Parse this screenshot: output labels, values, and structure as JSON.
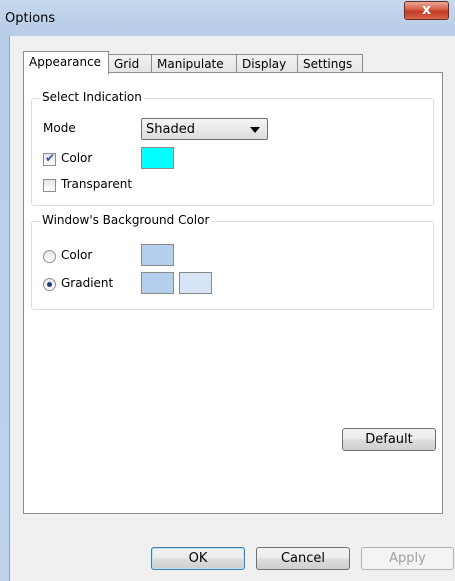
{
  "window": {
    "title": "Options",
    "close_glyph": "x"
  },
  "tabs": [
    {
      "label": "Appearance",
      "active": true
    },
    {
      "label": "Grid",
      "active": false
    },
    {
      "label": "Manipulate",
      "active": false
    },
    {
      "label": "Display",
      "active": false
    },
    {
      "label": "Settings",
      "active": false
    }
  ],
  "select_indication": {
    "legend": "Select Indication",
    "mode_label": "Mode",
    "mode_value": "Shaded",
    "color_label": "Color",
    "color_checked": true,
    "color_value": "#00ffff",
    "transparent_label": "Transparent",
    "transparent_checked": false
  },
  "background": {
    "legend": "Window's Background Color",
    "color_label": "Color",
    "gradient_label": "Gradient",
    "selected": "gradient",
    "solid_color": "#b7cfee",
    "gradient_color_1": "#b7cfee",
    "gradient_color_2": "#d6e4f5"
  },
  "buttons": {
    "default": "Default",
    "ok": "OK",
    "cancel": "Cancel",
    "apply": "Apply"
  }
}
